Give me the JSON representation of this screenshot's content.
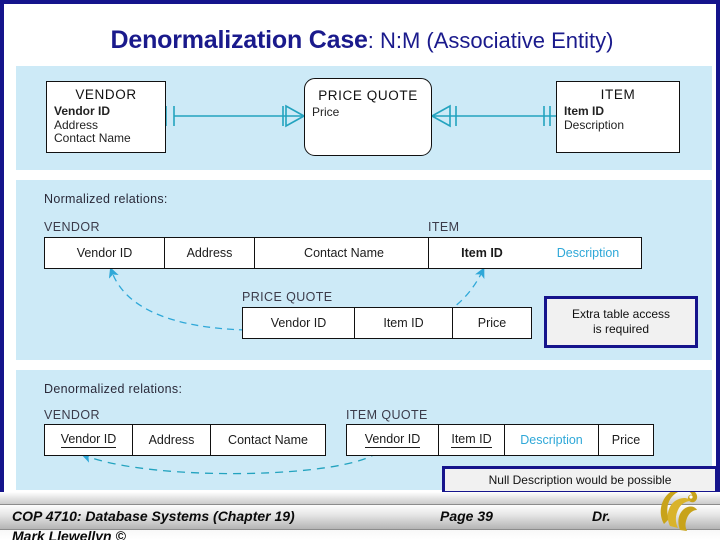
{
  "title": {
    "bold": "Denormalization Case",
    "rest": ": N:M (Associative Entity)"
  },
  "colors": {
    "slide_border": "#15148c",
    "panel_bg": "#cdeaf7",
    "title_text": "#1a1a8c",
    "fk_text": "#2fa8d8",
    "arrow": "#2fa8d8",
    "callout_border": "#15148c"
  },
  "er_diagram": {
    "entities": [
      {
        "name": "VENDOR",
        "attrs": [
          {
            "text": "Vendor ID",
            "key": true
          },
          {
            "text": "Address",
            "key": false
          },
          {
            "text": "Contact Name",
            "key": false
          }
        ],
        "shape": "rect"
      },
      {
        "name": "PRICE QUOTE",
        "attrs": [
          {
            "text": "Price",
            "key": false
          }
        ],
        "shape": "rounded"
      },
      {
        "name": "ITEM",
        "attrs": [
          {
            "text": "Item ID",
            "key": true
          },
          {
            "text": "Description",
            "key": false
          }
        ],
        "shape": "rect"
      }
    ]
  },
  "normalized": {
    "heading": "Normalized relations:",
    "tables": [
      {
        "label": "VENDOR",
        "columns": [
          {
            "text": "Vendor ID",
            "underline": false,
            "fk": false
          },
          {
            "text": "Address",
            "underline": false,
            "fk": false
          },
          {
            "text": "Contact Name",
            "underline": false,
            "fk": false
          }
        ]
      },
      {
        "label": "ITEM",
        "columns": [
          {
            "text": "Item ID",
            "underline": false,
            "fk": false,
            "bold": true
          },
          {
            "text": "Description",
            "underline": false,
            "fk": true
          }
        ]
      },
      {
        "label": "PRICE QUOTE",
        "columns": [
          {
            "text": "Vendor ID",
            "underline": false,
            "fk": false
          },
          {
            "text": "Item ID",
            "underline": false,
            "fk": false
          },
          {
            "text": "Price",
            "underline": false,
            "fk": false
          }
        ]
      }
    ],
    "callout": "Extra table access is required",
    "callout_line1": "Extra table access",
    "callout_line2": "is required"
  },
  "denormalized": {
    "heading": "Denormalized relations:",
    "tables": [
      {
        "label": "VENDOR",
        "columns": [
          {
            "text": "Vendor ID",
            "underline": true,
            "fk": false
          },
          {
            "text": "Address",
            "underline": false,
            "fk": false
          },
          {
            "text": "Contact Name",
            "underline": false,
            "fk": false
          }
        ]
      },
      {
        "label": "ITEM QUOTE",
        "columns": [
          {
            "text": "Vendor ID",
            "underline": true,
            "fk": false
          },
          {
            "text": "Item ID",
            "underline": true,
            "fk": false
          },
          {
            "text": "Description",
            "underline": false,
            "fk": true
          },
          {
            "text": "Price",
            "underline": false,
            "fk": false
          }
        ]
      }
    ],
    "callout": "Null Description would be possible"
  },
  "footer": {
    "course": "COP 4710: Database Systems  (Chapter 19)",
    "page": "Page 39",
    "dr": "Dr.",
    "author": "Mark Llewellyn ©"
  }
}
